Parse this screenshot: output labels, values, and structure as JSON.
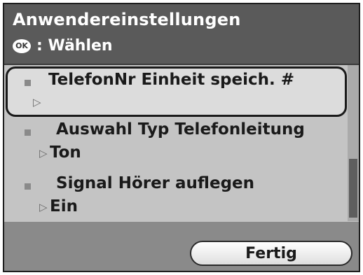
{
  "header": {
    "title": "Anwendereinstellungen",
    "ok_icon_label": "OK",
    "subtitle": ": Wählen"
  },
  "items": [
    {
      "label": "TelefonNr Einheit speich. #",
      "value": "",
      "selected": true
    },
    {
      "label": "Auswahl Typ Telefonleitung",
      "value": "Ton",
      "selected": false
    },
    {
      "label": "Signal Hörer auflegen",
      "value": "Ein",
      "selected": false
    }
  ],
  "arrow_glyph": "▷",
  "footer": {
    "done_label": "Fertig"
  },
  "scroll_position": 0.65,
  "colors": {
    "header_bg": "#5a5a5a",
    "list_bg": "#c4c4c4",
    "footer_bg": "#8a8a8a",
    "text": "#1a1a1a"
  }
}
